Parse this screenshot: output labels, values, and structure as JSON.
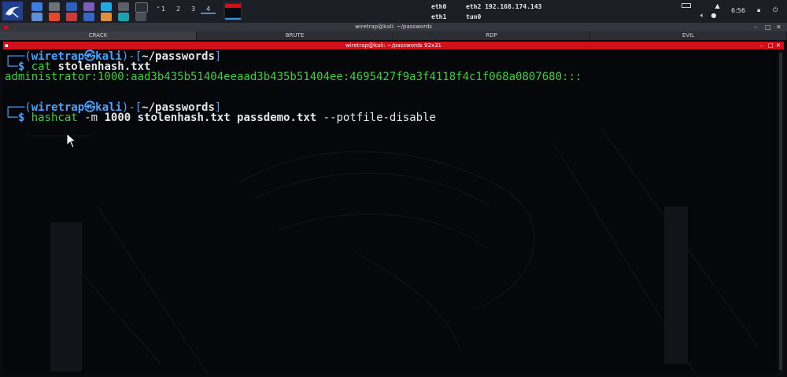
{
  "panel": {
    "workspaces": [
      "1",
      "2",
      "3",
      "4"
    ],
    "network": {
      "eth0": "eth0",
      "eth1": "eth1",
      "eth2": "eth2",
      "eth2_ip": "192.168.174.143",
      "tun0": "tun0"
    },
    "clock": "6:56"
  },
  "window": {
    "title": "wiretrap@kali: ~/passwords",
    "tabs": [
      "CRACK",
      "BRUTE",
      "RDP",
      "EVIL"
    ],
    "active_tab": "CRACK"
  },
  "terminal": {
    "title": "wiretrap@kali: ~/passwords 92x31",
    "prompt_user": "wiretrap",
    "prompt_host": "kali",
    "prompt_dir": "~/passwords",
    "cmd1": "cat",
    "cmd1_args": "stolenhash.txt",
    "output1": "administrator:1000:aad3b435b51404eeaad3b435b51404ee:4695427f9a3f4118f4c1f068a0807680:::",
    "cmd2": "hashcat",
    "cmd2_flag": "-m",
    "cmd2_mode": "1000",
    "cmd2_files": "stolenhash.txt passdemo.txt",
    "cmd2_opt": "--potfile-disable"
  },
  "colors": {
    "prompt_green": "#3bd13b",
    "prompt_blue": "#4aa3ff",
    "titlebar_red": "#d0101d"
  }
}
